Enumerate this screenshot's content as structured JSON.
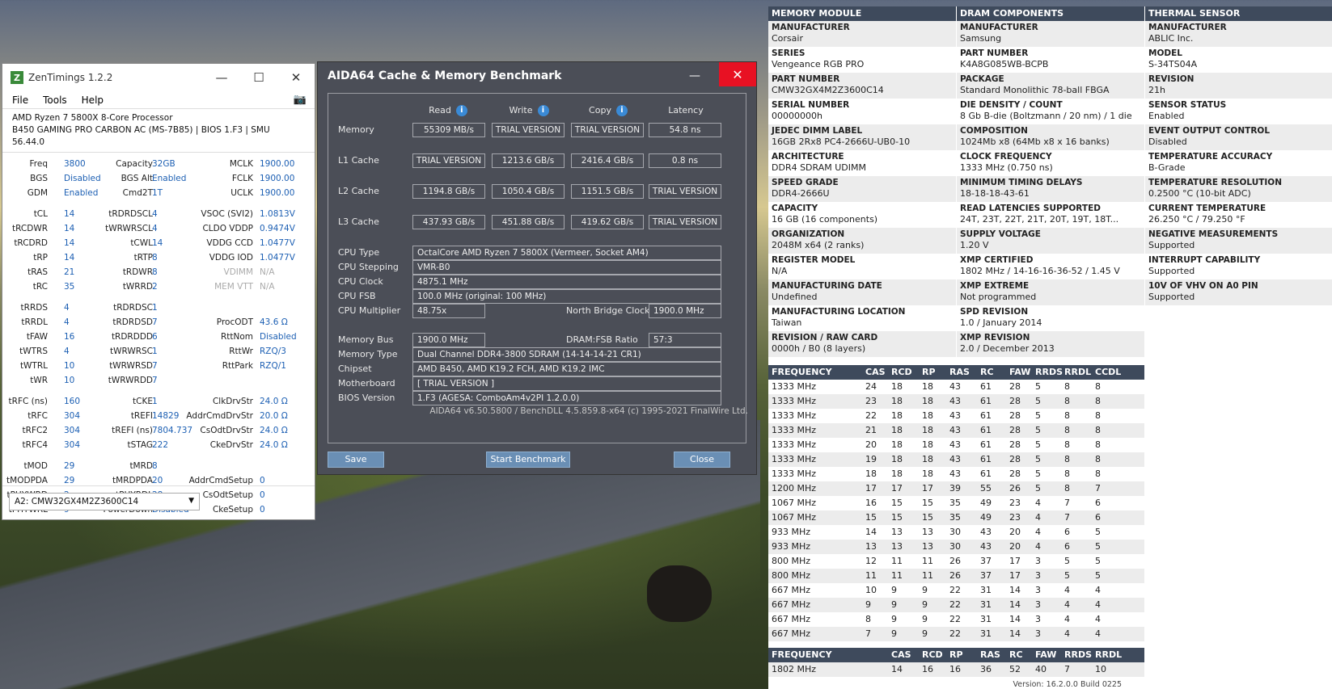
{
  "zt": {
    "title": "ZenTimings 1.2.2",
    "menu": [
      "File",
      "Tools",
      "Help"
    ],
    "cpu": "AMD Ryzen 7 5800X 8-Core Processor",
    "board": "B450 GAMING PRO CARBON AC (MS-7B85) | BIOS 1.F3 | SMU 56.44.0",
    "rows": [
      [
        [
          "Freq",
          "3800"
        ],
        [
          "Capacity",
          "32GB"
        ],
        [
          "MCLK",
          "1900.00"
        ]
      ],
      [
        [
          "BGS",
          "Disabled"
        ],
        [
          "BGS Alt",
          "Enabled"
        ],
        [
          "FCLK",
          "1900.00"
        ]
      ],
      [
        [
          "GDM",
          "Enabled"
        ],
        [
          "Cmd2T",
          "1T"
        ],
        [
          "UCLK",
          "1900.00"
        ]
      ],
      [
        [
          "tCL",
          "14"
        ],
        [
          "tRDRDSCL",
          "4"
        ],
        [
          "VSOC (SVI2)",
          "1.0813V"
        ]
      ],
      [
        [
          "tRCDWR",
          "14"
        ],
        [
          "tWRWRSCL",
          "4"
        ],
        [
          "CLDO VDDP",
          "0.9474V"
        ]
      ],
      [
        [
          "tRCDRD",
          "14"
        ],
        [
          "tCWL",
          "14"
        ],
        [
          "VDDG CCD",
          "1.0477V"
        ]
      ],
      [
        [
          "tRP",
          "14"
        ],
        [
          "tRTP",
          "8"
        ],
        [
          "VDDG IOD",
          "1.0477V"
        ]
      ],
      [
        [
          "tRAS",
          "21"
        ],
        [
          "tRDWR",
          "8"
        ],
        [
          "VDIMM",
          "N/A"
        ]
      ],
      [
        [
          "tRC",
          "35"
        ],
        [
          "tWRRD",
          "2"
        ],
        [
          "MEM VTT",
          "N/A"
        ]
      ],
      [
        [
          "tRRDS",
          "4"
        ],
        [
          "tRDRDSC",
          "1"
        ],
        [
          "",
          ""
        ]
      ],
      [
        [
          "tRRDL",
          "4"
        ],
        [
          "tRDRDSD",
          "7"
        ],
        [
          "ProcODT",
          "43.6 Ω"
        ]
      ],
      [
        [
          "tFAW",
          "16"
        ],
        [
          "tRDRDDD",
          "6"
        ],
        [
          "RttNom",
          "Disabled"
        ]
      ],
      [
        [
          "tWTRS",
          "4"
        ],
        [
          "tWRWRSC",
          "1"
        ],
        [
          "RttWr",
          "RZQ/3"
        ]
      ],
      [
        [
          "tWTRL",
          "10"
        ],
        [
          "tWRWRSD",
          "7"
        ],
        [
          "RttPark",
          "RZQ/1"
        ]
      ],
      [
        [
          "tWR",
          "10"
        ],
        [
          "tWRWRDD",
          "7"
        ],
        [
          "",
          ""
        ]
      ],
      [
        [
          "tRFC (ns)",
          "160"
        ],
        [
          "tCKE",
          "1"
        ],
        [
          "ClkDrvStr",
          "24.0 Ω"
        ]
      ],
      [
        [
          "tRFC",
          "304"
        ],
        [
          "tREFI",
          "14829"
        ],
        [
          "AddrCmdDrvStr",
          "20.0 Ω"
        ]
      ],
      [
        [
          "tRFC2",
          "304"
        ],
        [
          "tREFI (ns)",
          "7804.737"
        ],
        [
          "CsOdtDrvStr",
          "24.0 Ω"
        ]
      ],
      [
        [
          "tRFC4",
          "304"
        ],
        [
          "tSTAG",
          "222"
        ],
        [
          "CkeDrvStr",
          "24.0 Ω"
        ]
      ],
      [
        [
          "tMOD",
          "29"
        ],
        [
          "tMRD",
          "8"
        ],
        [
          "",
          ""
        ]
      ],
      [
        [
          "tMODPDA",
          "29"
        ],
        [
          "tMRDPDA",
          "20"
        ],
        [
          "AddrCmdSetup",
          "0"
        ]
      ],
      [
        [
          "tPHYWRD",
          "2"
        ],
        [
          "tPHYRDL",
          "28"
        ],
        [
          "CsOdtSetup",
          "0"
        ]
      ],
      [
        [
          "tPHYWRL",
          "9"
        ],
        [
          "PowerDown",
          "Disabled"
        ],
        [
          "CkeSetup",
          "0"
        ]
      ]
    ],
    "dimm": "A2: CMW32GX4M2Z3600C14"
  },
  "aida": {
    "title": "AIDA64 Cache & Memory Benchmark",
    "headers": [
      "Read",
      "Write",
      "Copy",
      "Latency"
    ],
    "bench": [
      {
        "label": "Memory",
        "vals": [
          "55309 MB/s",
          "TRIAL VERSION",
          "TRIAL VERSION",
          "54.8 ns"
        ]
      },
      {
        "label": "L1 Cache",
        "vals": [
          "TRIAL VERSION",
          "1213.6 GB/s",
          "2416.4 GB/s",
          "0.8 ns"
        ]
      },
      {
        "label": "L2 Cache",
        "vals": [
          "1194.8 GB/s",
          "1050.4 GB/s",
          "1151.5 GB/s",
          "TRIAL VERSION"
        ]
      },
      {
        "label": "L3 Cache",
        "vals": [
          "437.93 GB/s",
          "451.88 GB/s",
          "419.62 GB/s",
          "TRIAL VERSION"
        ]
      }
    ],
    "cpu_type_l": "CPU Type",
    "cpu_type": "OctalCore AMD Ryzen 7 5800X  (Vermeer, Socket AM4)",
    "cpu_step_l": "CPU Stepping",
    "cpu_step": "VMR-B0",
    "cpu_clock_l": "CPU Clock",
    "cpu_clock": "4875.1 MHz",
    "cpu_fsb_l": "CPU FSB",
    "cpu_fsb": "100.0 MHz  (original: 100 MHz)",
    "cpu_mult_l": "CPU Multiplier",
    "cpu_mult": "48.75x",
    "nb_l": "North Bridge Clock",
    "nb": "1900.0 MHz",
    "bus_l": "Memory Bus",
    "bus": "1900.0 MHz",
    "ratio_l": "DRAM:FSB Ratio",
    "ratio": "57:3",
    "mtype_l": "Memory Type",
    "mtype": "Dual Channel DDR4-3800 SDRAM  (14-14-14-21 CR1)",
    "chipset_l": "Chipset",
    "chipset": "AMD B450, AMD K19.2 FCH, AMD K19.2 IMC",
    "mobo_l": "Motherboard",
    "mobo": "[ TRIAL VERSION ]",
    "bios_l": "BIOS Version",
    "bios": "1.F3  (AGESA: ComboAm4v2PI 1.2.0.0)",
    "copyright": "AIDA64 v6.50.5800 / BenchDLL 4.5.859.8-x64  (c) 1995-2021 FinalWire Ltd.",
    "save": "Save",
    "start": "Start Benchmark",
    "close": "Close"
  },
  "spd": {
    "cols": [
      {
        "header": "MEMORY MODULE",
        "items": [
          [
            "MANUFACTURER",
            "Corsair"
          ],
          [
            "SERIES",
            "Vengeance RGB PRO"
          ],
          [
            "PART NUMBER",
            "CMW32GX4M2Z3600C14"
          ],
          [
            "SERIAL NUMBER",
            "00000000h"
          ],
          [
            "JEDEC DIMM LABEL",
            "16GB 2Rx8 PC4-2666U-UB0-10"
          ],
          [
            "ARCHITECTURE",
            "DDR4 SDRAM UDIMM"
          ],
          [
            "SPEED GRADE",
            "DDR4-2666U"
          ],
          [
            "CAPACITY",
            "16 GB (16 components)"
          ],
          [
            "ORGANIZATION",
            "2048M x64 (2 ranks)"
          ],
          [
            "REGISTER MODEL",
            "N/A"
          ],
          [
            "MANUFACTURING DATE",
            "Undefined"
          ],
          [
            "MANUFACTURING LOCATION",
            "Taiwan"
          ],
          [
            "REVISION / RAW CARD",
            "0000h / B0 (8 layers)"
          ]
        ]
      },
      {
        "header": "DRAM COMPONENTS",
        "items": [
          [
            "MANUFACTURER",
            "Samsung"
          ],
          [
            "PART NUMBER",
            "K4A8G085WB-BCPB"
          ],
          [
            "PACKAGE",
            "Standard Monolithic 78-ball FBGA"
          ],
          [
            "DIE DENSITY / COUNT",
            "8 Gb B-die (Boltzmann / 20 nm) / 1 die"
          ],
          [
            "COMPOSITION",
            "1024Mb x8 (64Mb x8 x 16 banks)"
          ],
          [
            "CLOCK FREQUENCY",
            "1333 MHz (0.750 ns)"
          ],
          [
            "MINIMUM TIMING DELAYS",
            "18-18-18-43-61"
          ],
          [
            "READ LATENCIES SUPPORTED",
            "24T, 23T, 22T, 21T, 20T, 19T, 18T..."
          ],
          [
            "SUPPLY VOLTAGE",
            "1.20 V"
          ],
          [
            "XMP CERTIFIED",
            "1802 MHz / 14-16-16-36-52 / 1.45 V"
          ],
          [
            "XMP EXTREME",
            "Not programmed"
          ],
          [
            "SPD REVISION",
            "1.0 / January 2014"
          ],
          [
            "XMP REVISION",
            "2.0 / December 2013"
          ]
        ]
      },
      {
        "header": "THERMAL SENSOR",
        "items": [
          [
            "MANUFACTURER",
            "ABLIC Inc."
          ],
          [
            "MODEL",
            "S-34TS04A"
          ],
          [
            "REVISION",
            "21h"
          ],
          [
            "SENSOR STATUS",
            "Enabled"
          ],
          [
            "EVENT OUTPUT CONTROL",
            "Disabled"
          ],
          [
            "TEMPERATURE ACCURACY",
            "B-Grade"
          ],
          [
            "TEMPERATURE RESOLUTION",
            "0.2500 °C (10-bit ADC)"
          ],
          [
            "CURRENT TEMPERATURE",
            "26.250 °C / 79.250 °F"
          ],
          [
            "NEGATIVE MEASUREMENTS",
            "Supported"
          ],
          [
            "INTERRUPT CAPABILITY",
            "Supported"
          ],
          [
            "10V OF VHV ON A0 PIN",
            "Supported"
          ]
        ]
      }
    ],
    "freq_headers": [
      "FREQUENCY",
      "CAS",
      "RCD",
      "RP",
      "RAS",
      "RC",
      "FAW",
      "RRDS",
      "RRDL",
      "CCDL"
    ],
    "freq_rows": [
      [
        "1333 MHz",
        "24",
        "18",
        "18",
        "43",
        "61",
        "28",
        "5",
        "8",
        "8"
      ],
      [
        "1333 MHz",
        "23",
        "18",
        "18",
        "43",
        "61",
        "28",
        "5",
        "8",
        "8"
      ],
      [
        "1333 MHz",
        "22",
        "18",
        "18",
        "43",
        "61",
        "28",
        "5",
        "8",
        "8"
      ],
      [
        "1333 MHz",
        "21",
        "18",
        "18",
        "43",
        "61",
        "28",
        "5",
        "8",
        "8"
      ],
      [
        "1333 MHz",
        "20",
        "18",
        "18",
        "43",
        "61",
        "28",
        "5",
        "8",
        "8"
      ],
      [
        "1333 MHz",
        "19",
        "18",
        "18",
        "43",
        "61",
        "28",
        "5",
        "8",
        "8"
      ],
      [
        "1333 MHz",
        "18",
        "18",
        "18",
        "43",
        "61",
        "28",
        "5",
        "8",
        "8"
      ],
      [
        "1200 MHz",
        "17",
        "17",
        "17",
        "39",
        "55",
        "26",
        "5",
        "8",
        "7"
      ],
      [
        "1067 MHz",
        "16",
        "15",
        "15",
        "35",
        "49",
        "23",
        "4",
        "7",
        "6"
      ],
      [
        "1067 MHz",
        "15",
        "15",
        "15",
        "35",
        "49",
        "23",
        "4",
        "7",
        "6"
      ],
      [
        "933 MHz",
        "14",
        "13",
        "13",
        "30",
        "43",
        "20",
        "4",
        "6",
        "5"
      ],
      [
        "933 MHz",
        "13",
        "13",
        "13",
        "30",
        "43",
        "20",
        "4",
        "6",
        "5"
      ],
      [
        "800 MHz",
        "12",
        "11",
        "11",
        "26",
        "37",
        "17",
        "3",
        "5",
        "5"
      ],
      [
        "800 MHz",
        "11",
        "11",
        "11",
        "26",
        "37",
        "17",
        "3",
        "5",
        "5"
      ],
      [
        "667 MHz",
        "10",
        "9",
        "9",
        "22",
        "31",
        "14",
        "3",
        "4",
        "4"
      ],
      [
        "667 MHz",
        "9",
        "9",
        "9",
        "22",
        "31",
        "14",
        "3",
        "4",
        "4"
      ],
      [
        "667 MHz",
        "8",
        "9",
        "9",
        "22",
        "31",
        "14",
        "3",
        "4",
        "4"
      ],
      [
        "667 MHz",
        "7",
        "9",
        "9",
        "22",
        "31",
        "14",
        "3",
        "4",
        "4"
      ]
    ],
    "xmp_headers": [
      "FREQUENCY",
      "CAS",
      "RCD",
      "RP",
      "RAS",
      "RC",
      "FAW",
      "RRDS",
      "RRDL"
    ],
    "xmp_row": [
      "1802 MHz",
      "14",
      "16",
      "16",
      "36",
      "52",
      "40",
      "7",
      "10"
    ],
    "version": "Version: 16.2.0.0 Build 0225"
  }
}
